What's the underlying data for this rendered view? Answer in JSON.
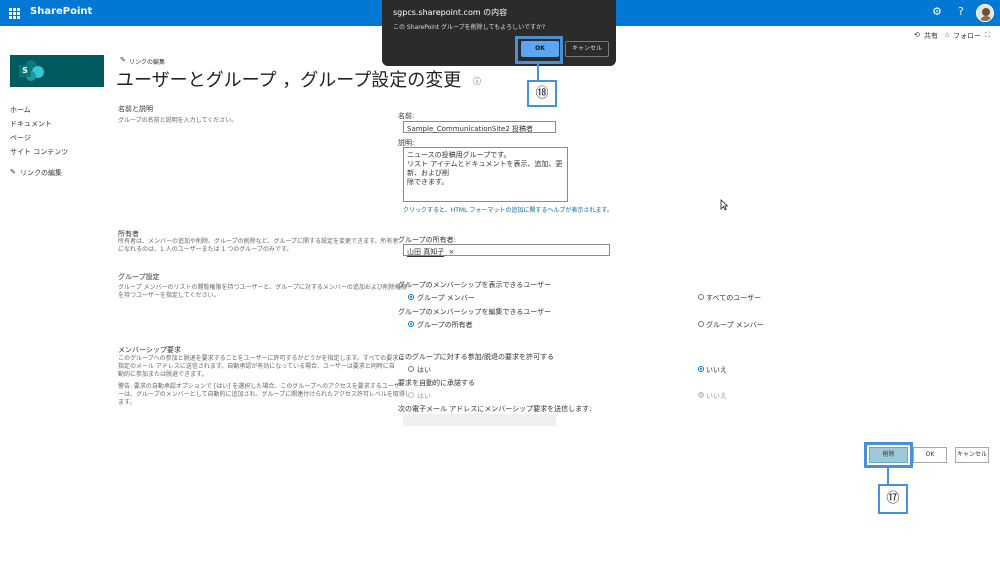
{
  "suite": {
    "app_name": "SharePoint",
    "settings_icon": "⚙",
    "help_icon": "?",
    "waffle_icon": "waffle-icon"
  },
  "command_bar": {
    "share_label": "共有",
    "follow_label": "フォロー",
    "share_icon": "⟲",
    "follow_icon": "☆",
    "expand_icon": "⛶"
  },
  "site": {
    "logo_letter": "S",
    "edit_links": "リンクの編集",
    "page_title": "ユーザーとグループ ，グループ設定の変更",
    "info_icon": "ⓘ"
  },
  "nav": {
    "items": [
      "ホーム",
      "ドキュメント",
      "ページ",
      "サイト コンテンツ"
    ],
    "edit_links": "リンクの編集",
    "edit_icon": "✎"
  },
  "sections": {
    "name_desc": {
      "heading": "名前と説明",
      "help": "グループの名前と説明を入力してください。",
      "name_label": "名前:",
      "name_value": "Sample_CommunicationSite2 投稿者",
      "desc_label": "説明:",
      "desc_lines": [
        "ニュースの投稿用グループです。",
        "リスト アイテムとドキュメントを表示、追加、更新、および削",
        "除できます。"
      ],
      "html_help_link": "クリックすると、HTML フォーマットの追加に関するヘルプが表示されます。"
    },
    "owner": {
      "heading": "所有者",
      "help_lines": [
        "所有者は、メンバーの追加や削除、グループの削除など、グループに関する設定を変更できます。所有者",
        "になれるのは、1 人のユーザーまたは 1 つのグループのみです。"
      ],
      "owner_label": "グループの所有者:",
      "owner_value": "山田 真知子",
      "remove_icon": "×"
    },
    "group_settings": {
      "heading": "グループ設定",
      "help_lines": [
        "グループ メンバーのリストの閲覧権限を持つユーザーと、グループに対するメンバーの追加および削除権限",
        "を持つユーザーを指定してください。"
      ],
      "view_label": "グループのメンバーシップを表示できるユーザー",
      "view_opt1": "グループ メンバー",
      "view_opt2": "すべてのユーザー",
      "edit_label": "グループのメンバーシップを編集できるユーザー",
      "edit_opt1": "グループの所有者",
      "edit_opt2": "グループ メンバー"
    },
    "membership": {
      "heading": "メンバーシップ要求",
      "help_lines": [
        "このグループへの参加と脱退を要求することをユーザーに許可するかどうかを指定します。すべての要求は",
        "指定のメール アドレスに送信されます。自動承認が有効になっている場合、ユーザーは要求と同時に自",
        "動的に参加または脱退できます。"
      ],
      "warning_lines": [
        "警告: 要求の自動承認オプションで [はい] を選択した場合、このグループへのアクセスを要求するユーザ",
        "ーは、グループのメンバーとして自動的に追加され、グループに関連付けられたアクセス許可レベルを取得し",
        "ます。"
      ],
      "allow_label": "このグループに対する参加/脱退の要求を許可する",
      "yes": "はい",
      "no": "いいえ",
      "auto_label": "要求を自動的に承諾する",
      "email_label": "次の電子メール アドレスにメンバーシップ要求を送信します:"
    }
  },
  "buttons": {
    "delete": "削除",
    "ok": "OK",
    "cancel": "キャンセル"
  },
  "dialog": {
    "title": "sgpcs.sharepoint.com の内容",
    "message": "この SharePoint グループを削除してもよろしいですか?",
    "ok": "OK",
    "cancel": "キャンセル"
  },
  "callouts": {
    "c18": "⑱",
    "c17": "⑰"
  },
  "colors": {
    "suite_bar": "#0078d4",
    "logo": "#005a5e",
    "highlight": "#4a90d9",
    "delete_button": "#9ec9d9",
    "link": "#0b6a9e"
  }
}
